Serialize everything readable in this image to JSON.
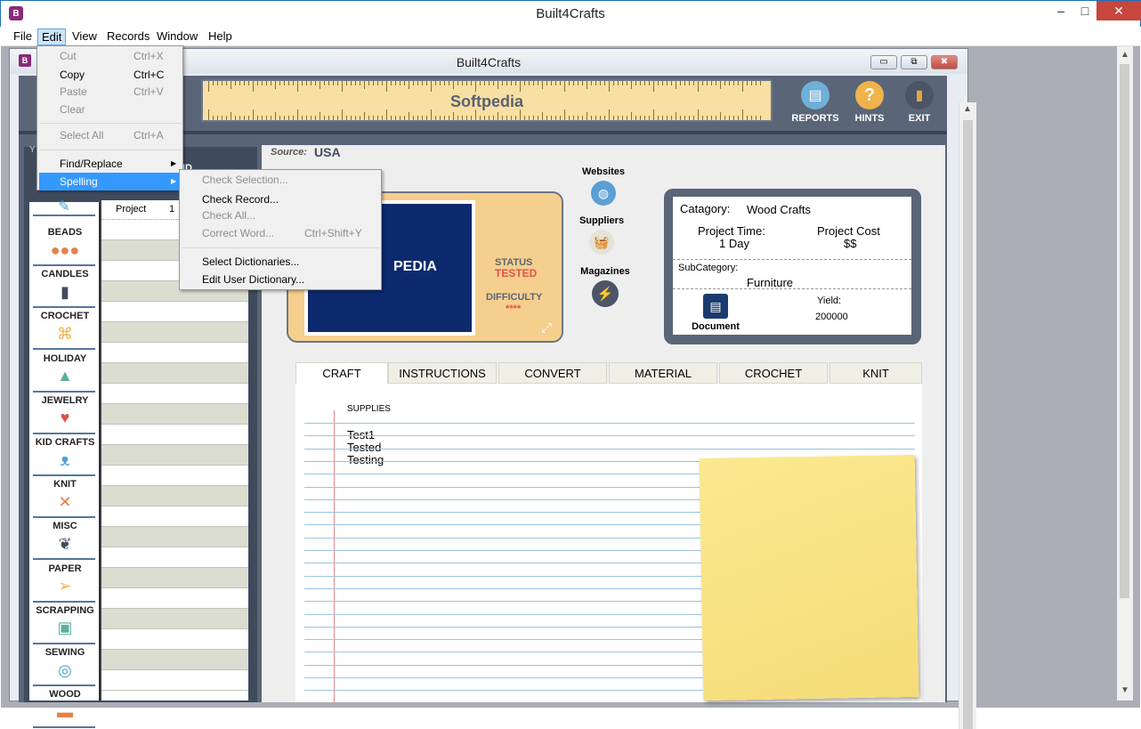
{
  "window": {
    "title": "Built4Crafts",
    "controls": [
      "–",
      "□",
      "✕"
    ]
  },
  "menubar": {
    "items": [
      "File",
      "Edit",
      "View",
      "Records",
      "Window",
      "Help"
    ]
  },
  "child": {
    "title": "Built4Crafts",
    "controls": [
      "▭",
      "⧉",
      "✖"
    ]
  },
  "header": {
    "ruler_text": "Softpedia",
    "buttons": [
      {
        "label": "REPORTS"
      },
      {
        "label": "HINTS"
      },
      {
        "label": "EXIT"
      }
    ]
  },
  "sidebar": {
    "partial_labels": {
      "top": "Y",
      "find": "IND",
      "column1": "Project",
      "column2": "1"
    },
    "categories": [
      "BEADS",
      "CANDLES",
      "CROCHET",
      "HOLIDAY",
      "JEWELRY",
      "KID CRAFTS",
      "KNIT",
      "MISC",
      "PAPER",
      "SCRAPPING",
      "SEWING",
      "WOOD"
    ]
  },
  "source": {
    "label": "Source:",
    "value": "USA"
  },
  "project": {
    "image_text": "PEDIA",
    "status_label": "STATUS",
    "status_value": "TESTED",
    "difficulty_label": "DIFFICULTY",
    "difficulty_value": "****"
  },
  "links": {
    "websites": "Websites",
    "suppliers": "Suppliers",
    "magazines": "Magazines"
  },
  "info": {
    "category_label": "Catagory:",
    "category_value": "Wood Crafts",
    "time_label": "Project Time:",
    "time_value": "1 Day",
    "cost_label": "Project Cost",
    "cost_value": "$$",
    "subcategory_label": "SubCategory:",
    "subcategory_value": "Furniture",
    "document_label": "Document",
    "yield_label": "Yield:",
    "yield_value": "200000"
  },
  "tabs": [
    "CRAFT",
    "INSTRUCTIONS",
    "CONVERT",
    "MATERIAL",
    "CROCHET",
    "KNIT"
  ],
  "notes": {
    "heading": "SUPPLIES",
    "lines": [
      "Test1",
      "Tested",
      "Testing"
    ]
  },
  "edit_menu": {
    "items": [
      {
        "label": "Cut",
        "shortcut": "Ctrl+X",
        "enabled": false
      },
      {
        "label": "Copy",
        "shortcut": "Ctrl+C",
        "enabled": true
      },
      {
        "label": "Paste",
        "shortcut": "Ctrl+V",
        "enabled": false
      },
      {
        "label": "Clear",
        "shortcut": "",
        "enabled": false
      },
      {
        "label": "Select All",
        "shortcut": "Ctrl+A",
        "enabled": false
      },
      {
        "label": "Find/Replace",
        "shortcut": "",
        "enabled": true
      },
      {
        "label": "Spelling",
        "shortcut": "",
        "enabled": true,
        "highlighted": true
      }
    ]
  },
  "spelling_menu": {
    "items": [
      {
        "label": "Check Selection...",
        "shortcut": "",
        "enabled": false
      },
      {
        "label": "Check Record...",
        "shortcut": "",
        "enabled": true
      },
      {
        "label": "Check All...",
        "shortcut": "",
        "enabled": false
      },
      {
        "label": "Correct Word...",
        "shortcut": "Ctrl+Shift+Y",
        "enabled": false
      },
      {
        "label": "Select Dictionaries...",
        "shortcut": "",
        "enabled": true
      },
      {
        "label": "Edit User Dictionary...",
        "shortcut": "",
        "enabled": true
      }
    ]
  },
  "colors": {
    "accent": "#3399ff",
    "status": "#e0534a",
    "panel": "#5a6678",
    "ruler": "#f8dfa3",
    "sticky": "#f8e488"
  }
}
